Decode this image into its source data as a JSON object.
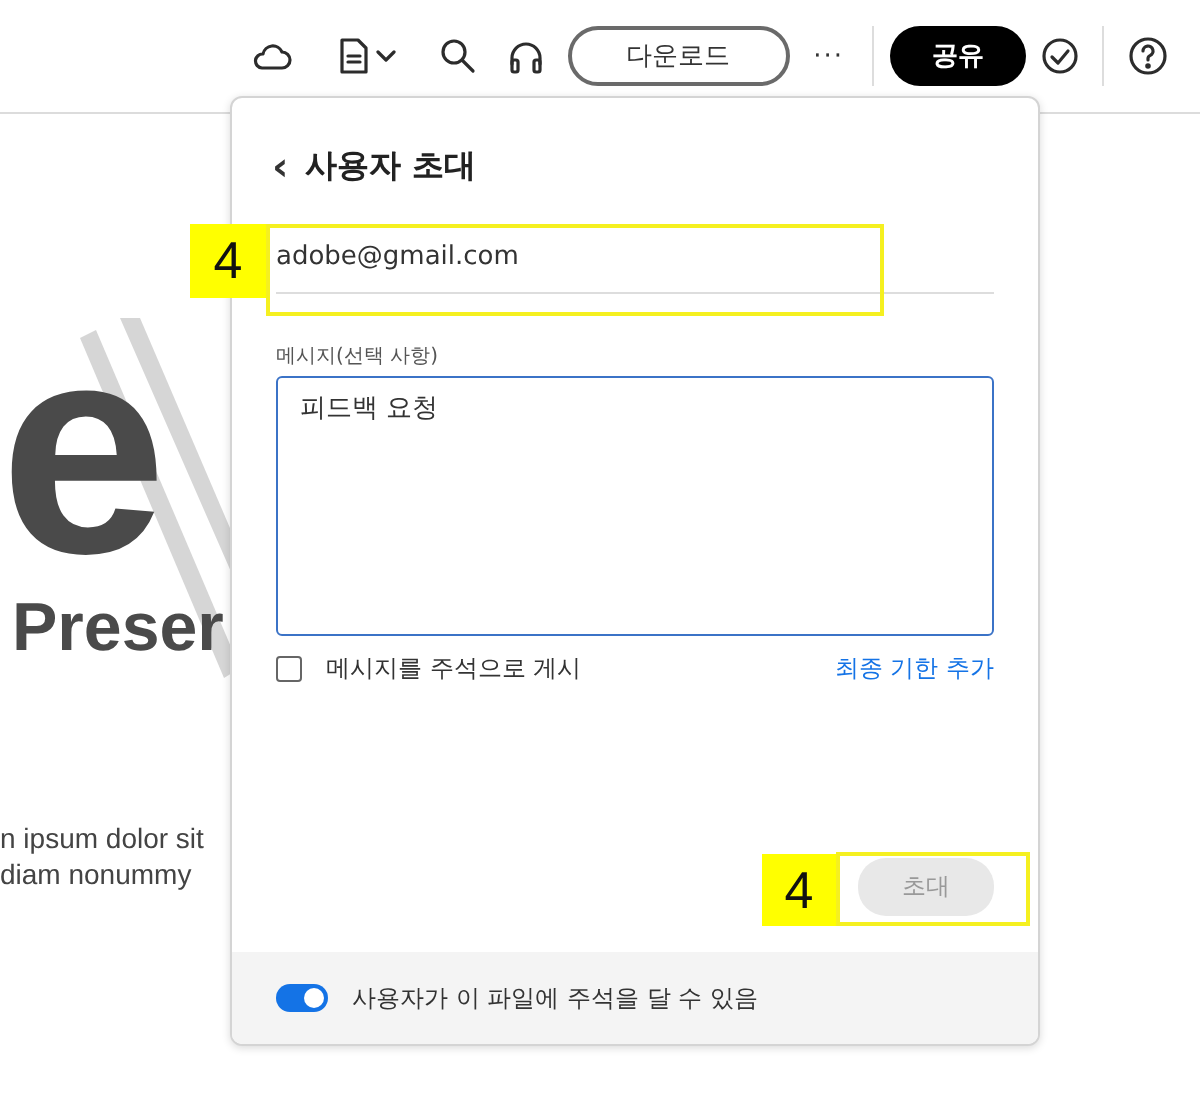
{
  "toolbar": {
    "download_button": "다운로드",
    "more": "···",
    "share_button": "공유"
  },
  "document": {
    "headline": "e",
    "subtitle": "Preser",
    "body_lines": [
      "n ipsum dolor sit",
      "diam nonummy"
    ]
  },
  "dialog": {
    "title": "사용자 초대",
    "back": "‹",
    "email": {
      "value": "adobe@gmail.com"
    },
    "message": {
      "label": "메시지(선택 사항)",
      "value": "피드백 요청"
    },
    "post_as_comment": {
      "label": "메시지를 주석으로 게시",
      "checked": false
    },
    "deadline_link": "최종 기한 추가",
    "invite_button": {
      "label": "초대",
      "disabled": true
    },
    "allow_comments": {
      "label": "사용자가 이 파일에 주석을 달 수 있음",
      "on": true
    }
  },
  "annotations": [
    {
      "kind": "badge",
      "label": "4"
    },
    {
      "kind": "badge",
      "label": "4"
    }
  ]
}
